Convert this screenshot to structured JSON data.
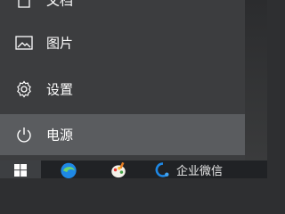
{
  "start_menu": {
    "items": [
      {
        "label": "文档",
        "icon": "document-icon"
      },
      {
        "label": "图片",
        "icon": "picture-icon"
      },
      {
        "label": "设置",
        "icon": "gear-icon"
      },
      {
        "label": "电源",
        "icon": "power-icon"
      }
    ]
  },
  "taskbar": {
    "apps": [
      {
        "icon": "edge-browser-icon"
      },
      {
        "icon": "paint-icon"
      },
      {
        "icon": "wecom-icon",
        "label": "企业微信"
      }
    ]
  },
  "colors": {
    "menu_bg": "#3c3d3f",
    "hover_bg": "#5a5c5f",
    "taskbar_bg": "#202225",
    "text": "#ffffff"
  }
}
